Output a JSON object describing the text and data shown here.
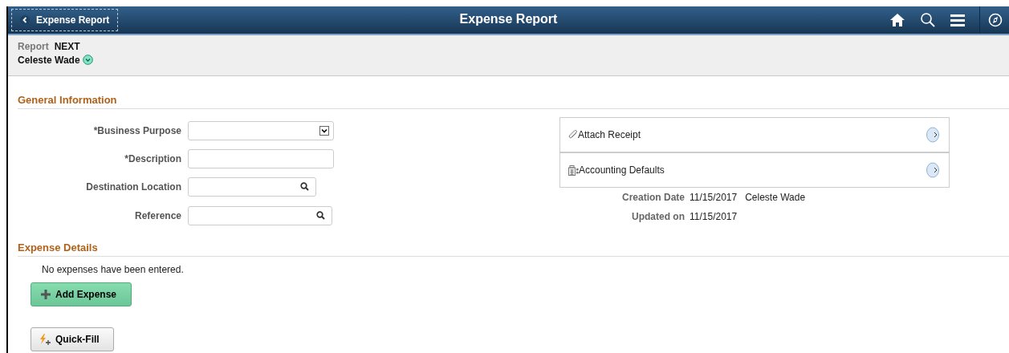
{
  "header": {
    "back_button": "Expense Report",
    "title": "Expense Report"
  },
  "summary": {
    "report_label": "Report",
    "report_value": "NEXT",
    "employee": "Celeste Wade"
  },
  "general_information": {
    "heading": "General Information",
    "fields": [
      {
        "label": "*Business Purpose",
        "kind": "select"
      },
      {
        "label": "*Description",
        "kind": "text"
      },
      {
        "label": "Destination Location",
        "kind": "lookup"
      },
      {
        "label": "Reference",
        "kind": "lookup"
      }
    ],
    "links": [
      {
        "label": "Attach Receipt",
        "kind": "paperclip"
      },
      {
        "label": "Accounting Defaults",
        "kind": "calculator"
      }
    ],
    "info": [
      {
        "label": "Creation Date",
        "value": "11/15/2017",
        "extra": "Celeste Wade"
      },
      {
        "label": "Updated on",
        "value": "11/15/2017"
      }
    ]
  },
  "expense_details": {
    "heading": "Expense Details",
    "message": "No expenses have been entered.",
    "add_button": "Add Expense",
    "quick_fill_button": "Quick-Fill"
  }
}
